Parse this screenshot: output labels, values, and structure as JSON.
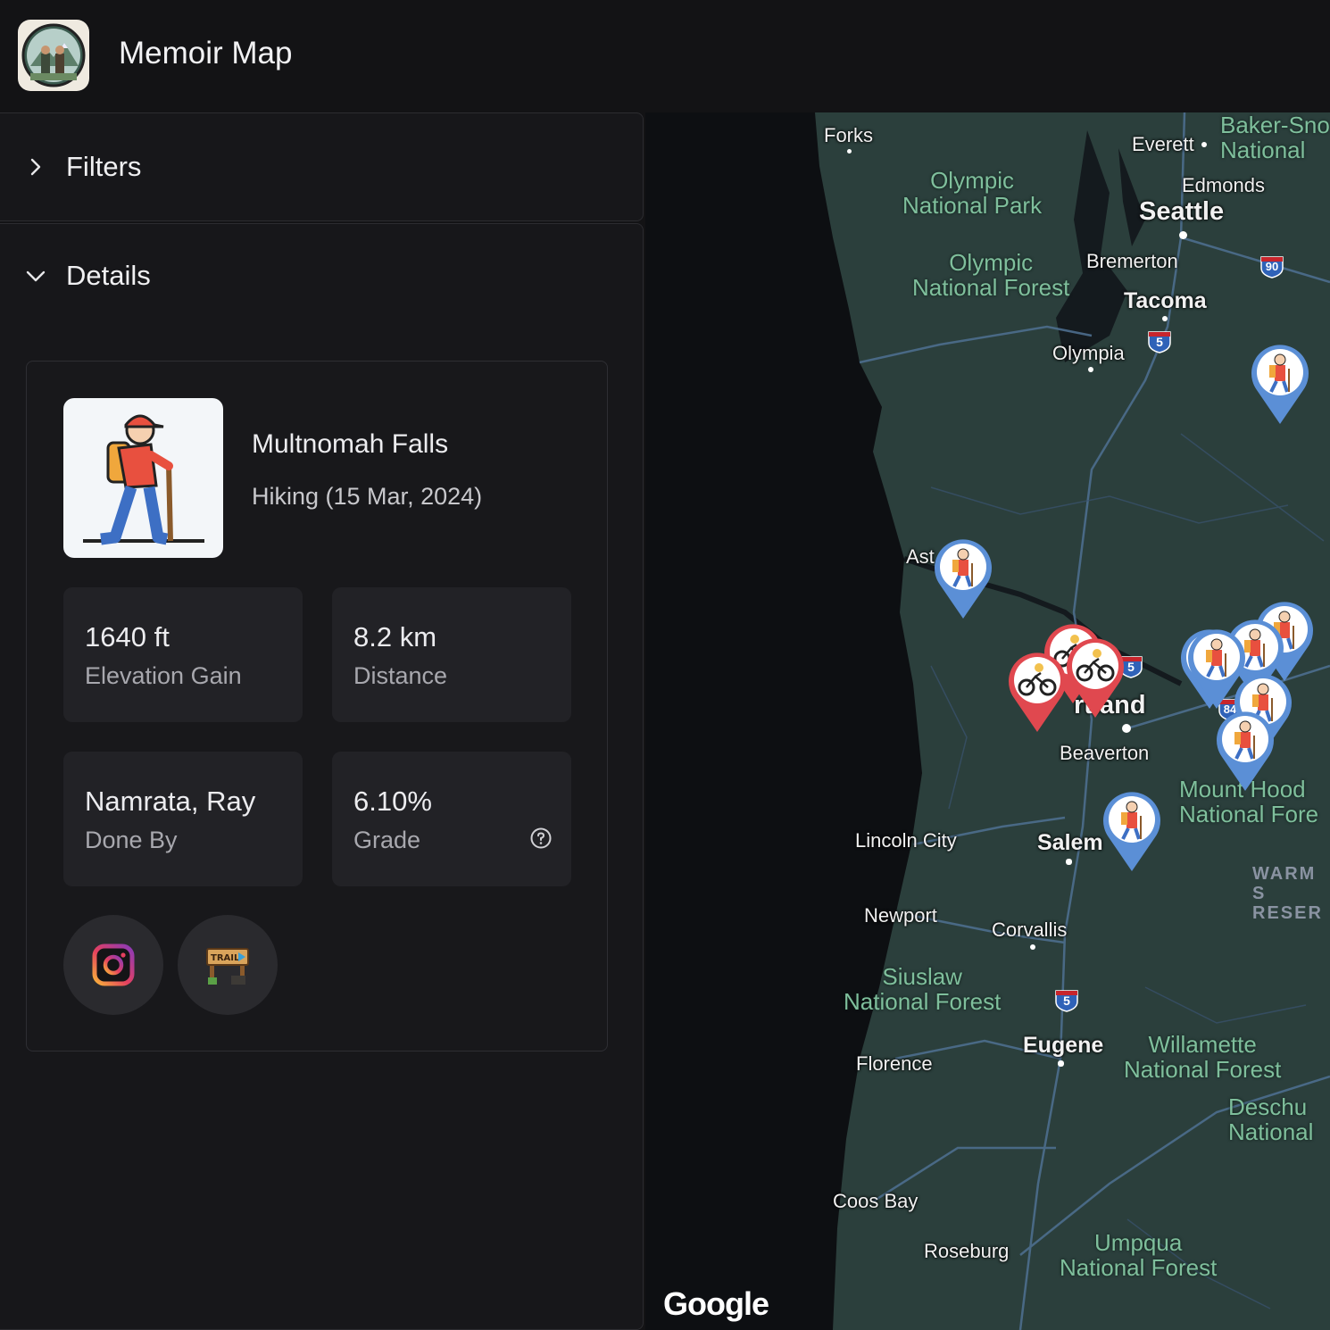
{
  "app": {
    "title": "Memoir Map"
  },
  "sidebar": {
    "filters": {
      "label": "Filters",
      "expanded": false
    },
    "details": {
      "label": "Details",
      "expanded": true,
      "activity": {
        "name": "Multnomah Falls",
        "subtitle": "Hiking (15 Mar, 2024)",
        "stats": [
          {
            "value": "1640 ft",
            "label": "Elevation Gain"
          },
          {
            "value": "8.2 km",
            "label": "Distance"
          },
          {
            "value": "Namrata, Ray",
            "label": "Done By"
          },
          {
            "value": "6.10%",
            "label": "Grade"
          }
        ],
        "links": [
          {
            "icon": "instagram-icon"
          },
          {
            "icon": "trail-sign-icon"
          }
        ]
      }
    }
  },
  "map": {
    "places": {
      "forks": "Forks",
      "everett": "Everett",
      "edmonds": "Edmonds",
      "seattle": "Seattle",
      "bremerton": "Bremerton",
      "tacoma": "Tacoma",
      "olympia": "Olympia",
      "astoria": "Ast",
      "portland": "rtland",
      "beaverton": "Beaverton",
      "lincoln_city": "Lincoln City",
      "salem": "Salem",
      "newport": "Newport",
      "corvallis": "Corvallis",
      "eugene": "Eugene",
      "florence": "Florence",
      "coos_bay": "Coos Bay",
      "roseburg": "Roseburg"
    },
    "parks": {
      "olympic_np": "Olympic\nNational Park",
      "olympic_nf": "Olympic\nNational Forest",
      "baker": "Baker-Sno\nNational",
      "mount_hood": "Mount Hood\nNational Fore",
      "siuslaw": "Siuslaw\nNational Forest",
      "willamette": "Willamette\nNational Forest",
      "deschutes": "Deschu\nNational",
      "umpqua": "Umpqua\nNational Forest"
    },
    "reservation": "WARM S\nRESER",
    "highways": [
      "90",
      "5",
      "5",
      "84",
      "5"
    ],
    "attribution": "Google",
    "colors": {
      "hiking_pin": "#5b8fd6",
      "biking_pin": "#e0484f"
    }
  }
}
